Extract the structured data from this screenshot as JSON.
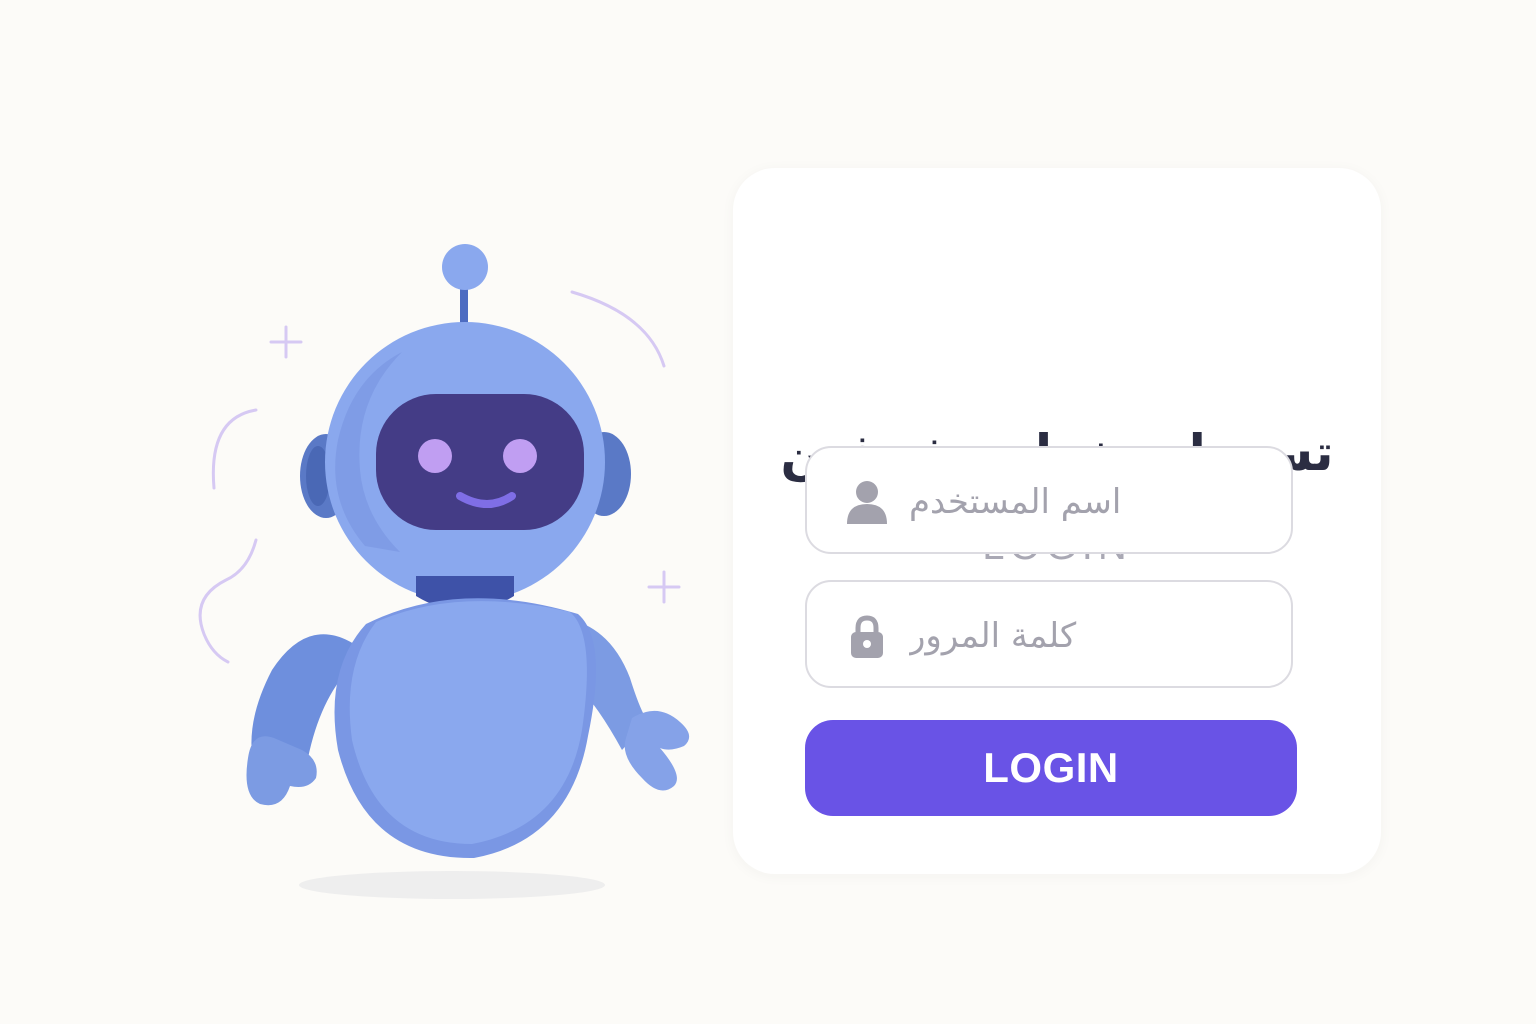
{
  "login_card": {
    "title": "تسجيل دخول مشرفين",
    "subtitle": "LOGIN",
    "username_field": {
      "placeholder": "اسم المستخدم",
      "value": "",
      "icon": "user-icon"
    },
    "password_field": {
      "placeholder": "كلمة المرور",
      "value": "",
      "icon": "lock-icon"
    },
    "submit_label": "LOGIN"
  },
  "illustration": {
    "subject": "robot-mascot"
  },
  "colors": {
    "background": "#fcfbf8",
    "card": "#ffffff",
    "title": "#2b2d42",
    "subtitle": "#a9a8b4",
    "field_border": "#dcdbe1",
    "placeholder": "#a3a2ad",
    "button": "#6953e6",
    "button_text": "#ffffff",
    "robot_body": "#8aa8ee",
    "robot_dark": "#5472c2",
    "robot_visor": "#443c86",
    "robot_eyes": "#c09ef2",
    "decor_lines": "#d6c9f3"
  }
}
